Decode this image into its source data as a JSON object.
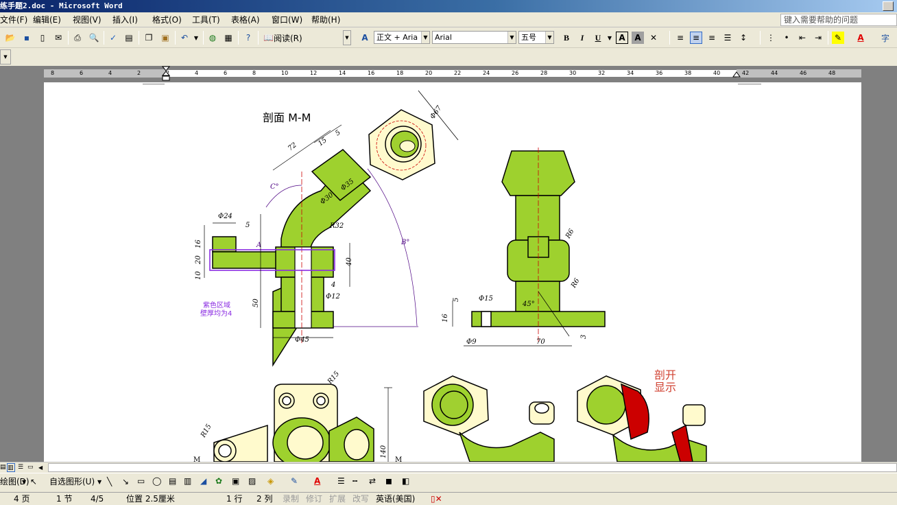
{
  "window": {
    "title": "练手题2.doc - Microsoft Word"
  },
  "menu": [
    "文件(F)",
    "编辑(E)",
    "视图(V)",
    "插入(I)",
    "格式(O)",
    "工具(T)",
    "表格(A)",
    "窗口(W)",
    "帮助(H)"
  ],
  "help_placeholder": "键入需要帮助的问题",
  "toolbar": {
    "read_label": "阅读(R)",
    "style_value": "正文 + Aria",
    "font_value": "Arial",
    "size_value": "五号",
    "bold": "B",
    "italic": "I",
    "underline": "U"
  },
  "ruler": {
    "labels": [
      "8",
      "6",
      "4",
      "2",
      "2",
      "4",
      "6",
      "8",
      "10",
      "12",
      "14",
      "16",
      "18",
      "20",
      "22",
      "24",
      "26",
      "28",
      "30",
      "32",
      "34",
      "36",
      "38",
      "40",
      "42",
      "44",
      "46",
      "48"
    ]
  },
  "drawing": {
    "section_title": "剖面 M-M",
    "purple_note_line1": "紫色区域",
    "purple_note_line2": "壁厚均为4",
    "cut_label_line1": "剖开",
    "cut_label_line2": "显示",
    "dims": {
      "d67": "Φ67",
      "d72": "72",
      "d15a": "15",
      "d5a": "5",
      "d35": "Φ35",
      "d30": "Φ30",
      "r32": "R32",
      "c": "C°",
      "b": "B°",
      "d24": "Φ24",
      "d5b": "5",
      "d16a": "16",
      "d20": "20",
      "d10": "10",
      "a": "A",
      "d40": "40",
      "d4": "4",
      "d12": "Φ12",
      "d50": "50",
      "d45": "Φ45",
      "r6a": "R6",
      "r6b": "R6",
      "d15b": "Φ15",
      "ang45": "45°",
      "d5c": "5",
      "d16b": "16",
      "d9": "Φ9",
      "d70": "70",
      "d3": "3",
      "r15a": "R15",
      "r15b": "R15",
      "d140": "140",
      "m1": "M",
      "m2": "M"
    }
  },
  "draw_toolbar": {
    "draw_label": "绘图(D)",
    "autoshape_label": "自选图形(U)"
  },
  "status": {
    "page": "4 页",
    "section": "1 节",
    "pages": "4/5",
    "position": "位置 2.5厘米",
    "line": "1 行",
    "col": "2 列",
    "rec": "录制",
    "trk": "修订",
    "ext": "扩展",
    "ovr": "改写",
    "lang": "英语(美国)"
  }
}
